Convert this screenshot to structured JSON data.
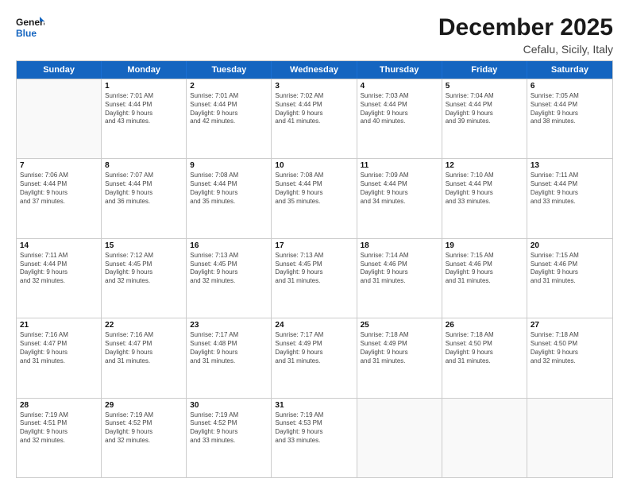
{
  "logo": {
    "line1": "General",
    "line2": "Blue"
  },
  "title": "December 2025",
  "subtitle": "Cefalu, Sicily, Italy",
  "days": [
    "Sunday",
    "Monday",
    "Tuesday",
    "Wednesday",
    "Thursday",
    "Friday",
    "Saturday"
  ],
  "weeks": [
    [
      {
        "day": "",
        "sunrise": "",
        "sunset": "",
        "daylight": ""
      },
      {
        "day": "1",
        "sunrise": "Sunrise: 7:01 AM",
        "sunset": "Sunset: 4:44 PM",
        "daylight": "Daylight: 9 hours",
        "daylight2": "and 43 minutes."
      },
      {
        "day": "2",
        "sunrise": "Sunrise: 7:01 AM",
        "sunset": "Sunset: 4:44 PM",
        "daylight": "Daylight: 9 hours",
        "daylight2": "and 42 minutes."
      },
      {
        "day": "3",
        "sunrise": "Sunrise: 7:02 AM",
        "sunset": "Sunset: 4:44 PM",
        "daylight": "Daylight: 9 hours",
        "daylight2": "and 41 minutes."
      },
      {
        "day": "4",
        "sunrise": "Sunrise: 7:03 AM",
        "sunset": "Sunset: 4:44 PM",
        "daylight": "Daylight: 9 hours",
        "daylight2": "and 40 minutes."
      },
      {
        "day": "5",
        "sunrise": "Sunrise: 7:04 AM",
        "sunset": "Sunset: 4:44 PM",
        "daylight": "Daylight: 9 hours",
        "daylight2": "and 39 minutes."
      },
      {
        "day": "6",
        "sunrise": "Sunrise: 7:05 AM",
        "sunset": "Sunset: 4:44 PM",
        "daylight": "Daylight: 9 hours",
        "daylight2": "and 38 minutes."
      }
    ],
    [
      {
        "day": "7",
        "sunrise": "Sunrise: 7:06 AM",
        "sunset": "Sunset: 4:44 PM",
        "daylight": "Daylight: 9 hours",
        "daylight2": "and 37 minutes."
      },
      {
        "day": "8",
        "sunrise": "Sunrise: 7:07 AM",
        "sunset": "Sunset: 4:44 PM",
        "daylight": "Daylight: 9 hours",
        "daylight2": "and 36 minutes."
      },
      {
        "day": "9",
        "sunrise": "Sunrise: 7:08 AM",
        "sunset": "Sunset: 4:44 PM",
        "daylight": "Daylight: 9 hours",
        "daylight2": "and 35 minutes."
      },
      {
        "day": "10",
        "sunrise": "Sunrise: 7:08 AM",
        "sunset": "Sunset: 4:44 PM",
        "daylight": "Daylight: 9 hours",
        "daylight2": "and 35 minutes."
      },
      {
        "day": "11",
        "sunrise": "Sunrise: 7:09 AM",
        "sunset": "Sunset: 4:44 PM",
        "daylight": "Daylight: 9 hours",
        "daylight2": "and 34 minutes."
      },
      {
        "day": "12",
        "sunrise": "Sunrise: 7:10 AM",
        "sunset": "Sunset: 4:44 PM",
        "daylight": "Daylight: 9 hours",
        "daylight2": "and 33 minutes."
      },
      {
        "day": "13",
        "sunrise": "Sunrise: 7:11 AM",
        "sunset": "Sunset: 4:44 PM",
        "daylight": "Daylight: 9 hours",
        "daylight2": "and 33 minutes."
      }
    ],
    [
      {
        "day": "14",
        "sunrise": "Sunrise: 7:11 AM",
        "sunset": "Sunset: 4:44 PM",
        "daylight": "Daylight: 9 hours",
        "daylight2": "and 32 minutes."
      },
      {
        "day": "15",
        "sunrise": "Sunrise: 7:12 AM",
        "sunset": "Sunset: 4:45 PM",
        "daylight": "Daylight: 9 hours",
        "daylight2": "and 32 minutes."
      },
      {
        "day": "16",
        "sunrise": "Sunrise: 7:13 AM",
        "sunset": "Sunset: 4:45 PM",
        "daylight": "Daylight: 9 hours",
        "daylight2": "and 32 minutes."
      },
      {
        "day": "17",
        "sunrise": "Sunrise: 7:13 AM",
        "sunset": "Sunset: 4:45 PM",
        "daylight": "Daylight: 9 hours",
        "daylight2": "and 31 minutes."
      },
      {
        "day": "18",
        "sunrise": "Sunrise: 7:14 AM",
        "sunset": "Sunset: 4:46 PM",
        "daylight": "Daylight: 9 hours",
        "daylight2": "and 31 minutes."
      },
      {
        "day": "19",
        "sunrise": "Sunrise: 7:15 AM",
        "sunset": "Sunset: 4:46 PM",
        "daylight": "Daylight: 9 hours",
        "daylight2": "and 31 minutes."
      },
      {
        "day": "20",
        "sunrise": "Sunrise: 7:15 AM",
        "sunset": "Sunset: 4:46 PM",
        "daylight": "Daylight: 9 hours",
        "daylight2": "and 31 minutes."
      }
    ],
    [
      {
        "day": "21",
        "sunrise": "Sunrise: 7:16 AM",
        "sunset": "Sunset: 4:47 PM",
        "daylight": "Daylight: 9 hours",
        "daylight2": "and 31 minutes."
      },
      {
        "day": "22",
        "sunrise": "Sunrise: 7:16 AM",
        "sunset": "Sunset: 4:47 PM",
        "daylight": "Daylight: 9 hours",
        "daylight2": "and 31 minutes."
      },
      {
        "day": "23",
        "sunrise": "Sunrise: 7:17 AM",
        "sunset": "Sunset: 4:48 PM",
        "daylight": "Daylight: 9 hours",
        "daylight2": "and 31 minutes."
      },
      {
        "day": "24",
        "sunrise": "Sunrise: 7:17 AM",
        "sunset": "Sunset: 4:49 PM",
        "daylight": "Daylight: 9 hours",
        "daylight2": "and 31 minutes."
      },
      {
        "day": "25",
        "sunrise": "Sunrise: 7:18 AM",
        "sunset": "Sunset: 4:49 PM",
        "daylight": "Daylight: 9 hours",
        "daylight2": "and 31 minutes."
      },
      {
        "day": "26",
        "sunrise": "Sunrise: 7:18 AM",
        "sunset": "Sunset: 4:50 PM",
        "daylight": "Daylight: 9 hours",
        "daylight2": "and 31 minutes."
      },
      {
        "day": "27",
        "sunrise": "Sunrise: 7:18 AM",
        "sunset": "Sunset: 4:50 PM",
        "daylight": "Daylight: 9 hours",
        "daylight2": "and 32 minutes."
      }
    ],
    [
      {
        "day": "28",
        "sunrise": "Sunrise: 7:19 AM",
        "sunset": "Sunset: 4:51 PM",
        "daylight": "Daylight: 9 hours",
        "daylight2": "and 32 minutes."
      },
      {
        "day": "29",
        "sunrise": "Sunrise: 7:19 AM",
        "sunset": "Sunset: 4:52 PM",
        "daylight": "Daylight: 9 hours",
        "daylight2": "and 32 minutes."
      },
      {
        "day": "30",
        "sunrise": "Sunrise: 7:19 AM",
        "sunset": "Sunset: 4:52 PM",
        "daylight": "Daylight: 9 hours",
        "daylight2": "and 33 minutes."
      },
      {
        "day": "31",
        "sunrise": "Sunrise: 7:19 AM",
        "sunset": "Sunset: 4:53 PM",
        "daylight": "Daylight: 9 hours",
        "daylight2": "and 33 minutes."
      },
      {
        "day": "",
        "sunrise": "",
        "sunset": "",
        "daylight": "",
        "daylight2": ""
      },
      {
        "day": "",
        "sunrise": "",
        "sunset": "",
        "daylight": "",
        "daylight2": ""
      },
      {
        "day": "",
        "sunrise": "",
        "sunset": "",
        "daylight": "",
        "daylight2": ""
      }
    ]
  ]
}
